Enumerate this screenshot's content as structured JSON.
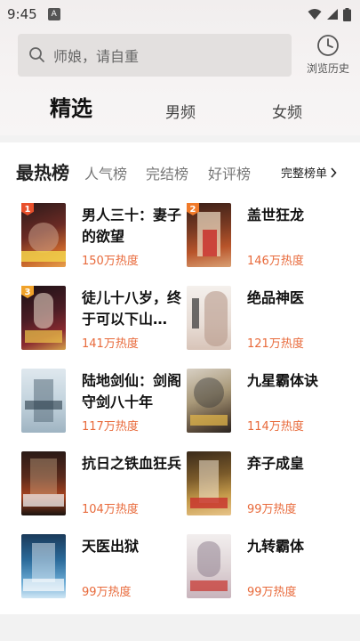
{
  "status_bar": {
    "time": "9:45",
    "app_badge": "A",
    "icons": [
      "wifi-icon",
      "signal-icon",
      "battery-icon"
    ]
  },
  "search": {
    "placeholder": "师娘，请自重",
    "icon": "search-icon"
  },
  "history": {
    "label": "浏览历史",
    "icon": "clock-icon"
  },
  "channels": [
    {
      "label": "精选",
      "active": true
    },
    {
      "label": "男频",
      "active": false
    },
    {
      "label": "女频",
      "active": false
    }
  ],
  "rank_tabs": {
    "hot": "最热榜",
    "popular": "人气榜",
    "finished": "完结榜",
    "good": "好评榜",
    "all_label": "完整榜单",
    "all_icon": "chevron-right-icon"
  },
  "books": [
    {
      "rank": "1",
      "title": "男人三十：妻子的欲望",
      "heat": "150万热度"
    },
    {
      "rank": "2",
      "title": "盖世狂龙",
      "heat": "146万热度"
    },
    {
      "rank": "3",
      "title": "徒儿十八岁，终于可以下山…",
      "heat": "141万热度"
    },
    {
      "rank": "",
      "title": "绝品神医",
      "heat": "121万热度"
    },
    {
      "rank": "",
      "title": "陆地剑仙：剑阁守剑八十年",
      "heat": "117万热度"
    },
    {
      "rank": "",
      "title": "九星霸体诀",
      "heat": "114万热度"
    },
    {
      "rank": "",
      "title": "抗日之铁血狂兵",
      "heat": "104万热度"
    },
    {
      "rank": "",
      "title": "弃子成皇",
      "heat": "99万热度"
    },
    {
      "rank": "",
      "title": "天医出狱",
      "heat": "99万热度"
    },
    {
      "rank": "",
      "title": "九转霸体",
      "heat": "99万热度"
    }
  ],
  "colors": {
    "heat": "#e86a3b",
    "rank1": "#e8502c",
    "rank2": "#f07a2a",
    "rank3": "#f0a22a"
  }
}
